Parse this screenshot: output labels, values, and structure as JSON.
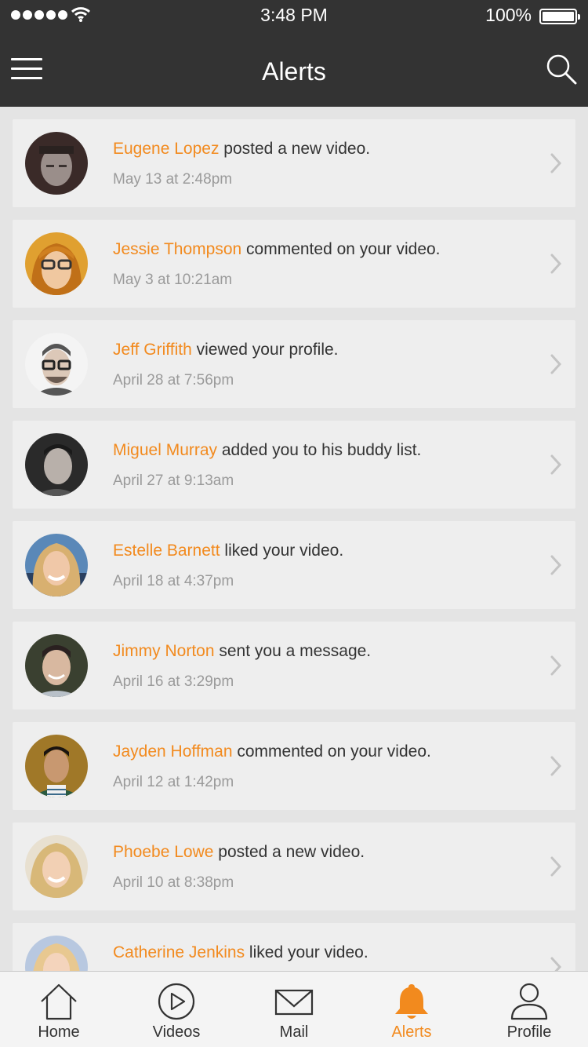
{
  "status": {
    "time": "3:48 PM",
    "battery": "100%"
  },
  "nav": {
    "title": "Alerts"
  },
  "alerts": [
    {
      "name": "Eugene Lopez",
      "action": " posted a new video.",
      "time": "May 13 at 2:48pm"
    },
    {
      "name": "Jessie Thompson",
      "action": " commented on your video.",
      "time": "May 3 at 10:21am"
    },
    {
      "name": "Jeff Griffith",
      "action": " viewed your profile.",
      "time": "April 28 at 7:56pm"
    },
    {
      "name": "Miguel Murray",
      "action": " added you to his buddy list.",
      "time": "April 27 at 9:13am"
    },
    {
      "name": "Estelle Barnett",
      "action": " liked your video.",
      "time": "April 18 at 4:37pm"
    },
    {
      "name": "Jimmy Norton",
      "action": " sent you a message.",
      "time": "April 16 at 3:29pm"
    },
    {
      "name": "Jayden Hoffman",
      "action": " commented on your video.",
      "time": "April 12 at 1:42pm"
    },
    {
      "name": "Phoebe Lowe",
      "action": " posted a new video.",
      "time": "April 10 at 8:38pm"
    },
    {
      "name": "Catherine Jenkins",
      "action": " liked your video.",
      "time": ""
    }
  ],
  "tabs": [
    {
      "label": "Home",
      "icon": "home-icon"
    },
    {
      "label": "Videos",
      "icon": "play-icon"
    },
    {
      "label": "Mail",
      "icon": "mail-icon"
    },
    {
      "label": "Alerts",
      "icon": "bell-icon",
      "active": true
    },
    {
      "label": "Profile",
      "icon": "person-icon"
    }
  ],
  "colors": {
    "accent": "#f28a1e",
    "bar": "#333333",
    "background": "#e4e4e4",
    "card": "#eeeeee"
  }
}
